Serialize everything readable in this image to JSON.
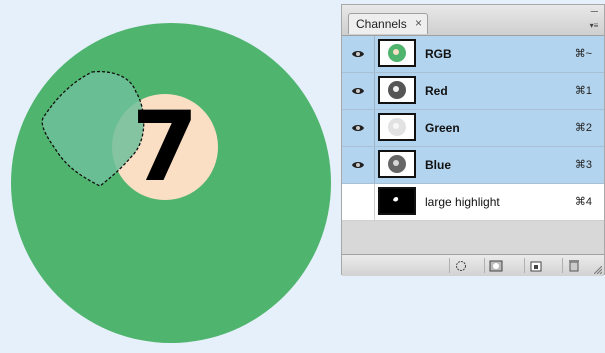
{
  "canvas": {
    "ball_number": "7",
    "colors": {
      "background": "#e5f0fa",
      "ball": "#4fb46d",
      "number_circle": "#fadfc5",
      "selection_fill": "#6fc09a"
    }
  },
  "panel": {
    "tab_label": "Channels",
    "tab_close_glyph": "×",
    "minimize_glyph": "–",
    "menu_glyph": "▾≡",
    "channels": [
      {
        "name": "RGB",
        "shortcut": "⌘~",
        "selected": true,
        "visible": true,
        "thumb": "rgb"
      },
      {
        "name": "Red",
        "shortcut": "⌘1",
        "selected": true,
        "visible": true,
        "thumb": "red"
      },
      {
        "name": "Green",
        "shortcut": "⌘2",
        "selected": true,
        "visible": true,
        "thumb": "green"
      },
      {
        "name": "Blue",
        "shortcut": "⌘3",
        "selected": true,
        "visible": true,
        "thumb": "blue"
      },
      {
        "name": "large highlight",
        "shortcut": "⌘4",
        "selected": false,
        "visible": false,
        "thumb": "alpha"
      }
    ],
    "bottom_buttons": [
      "load-selection-icon",
      "save-selection-icon",
      "new-channel-icon",
      "trash-icon"
    ],
    "colors": {
      "selected_row": "#b3d4ee",
      "panel_bg": "#d8d8d8"
    }
  }
}
